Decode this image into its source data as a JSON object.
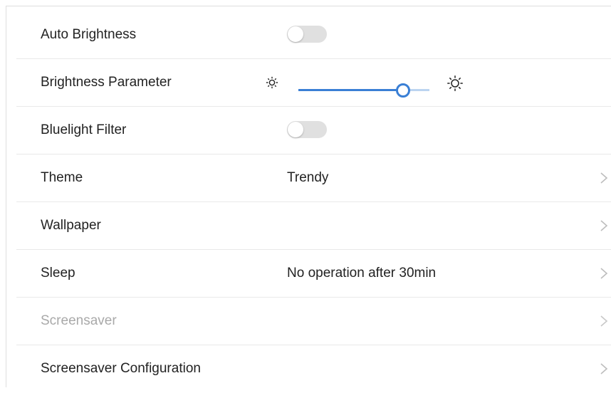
{
  "settings": {
    "auto_brightness": {
      "label": "Auto Brightness",
      "enabled": false
    },
    "brightness_parameter": {
      "label": "Brightness Parameter",
      "level": 0.8
    },
    "bluelight_filter": {
      "label": "Bluelight Filter",
      "enabled": false
    },
    "theme": {
      "label": "Theme",
      "value": "Trendy"
    },
    "wallpaper": {
      "label": "Wallpaper"
    },
    "sleep": {
      "label": "Sleep",
      "value": "No operation after 30min"
    },
    "screensaver": {
      "label": "Screensaver",
      "disabled": true
    },
    "screensaver_configuration": {
      "label": "Screensaver Configuration"
    }
  },
  "icons": {
    "brightness_low": "sun-small-icon",
    "brightness_high": "sun-large-icon",
    "chevron": "chevron-right-icon"
  },
  "colors": {
    "accent": "#3a7fd5",
    "toggle_off": "#e0e0e0",
    "disabled_text": "#a9a9a9"
  }
}
